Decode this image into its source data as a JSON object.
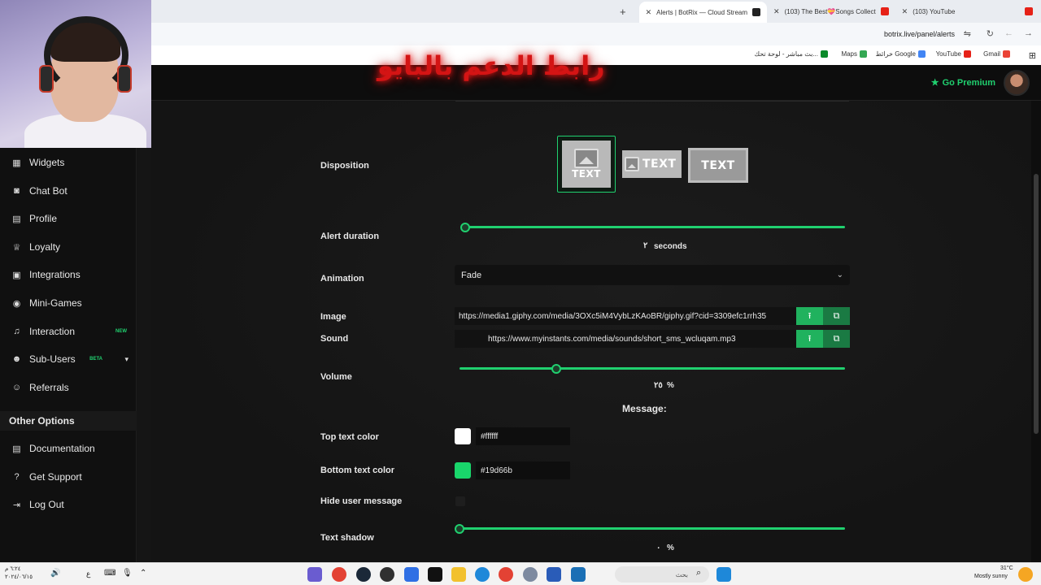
{
  "browser": {
    "tabs": [
      {
        "label": "Alerts | BotRix — Cloud Stream",
        "active": true
      },
      {
        "label": "(103) The Best💝Songs Collect",
        "active": false
      },
      {
        "label": "(103) YouTube",
        "active": false
      }
    ],
    "url": "botrix.live/panel/alerts",
    "bookmarks": [
      "بث مباشر - لوحة تحك...",
      "Maps",
      "خرائط Google",
      "YouTube",
      "Gmail"
    ]
  },
  "overlay_caption": "رابط الدعم بالبايو",
  "header": {
    "premium_label": "Go Premium"
  },
  "sidebar": {
    "items": [
      {
        "label": "Widgets",
        "icon": "widgets-icon"
      },
      {
        "label": "Chat Bot",
        "icon": "robot-icon"
      },
      {
        "label": "Profile",
        "icon": "profile-icon"
      },
      {
        "label": "Loyalty",
        "icon": "trophy-icon"
      },
      {
        "label": "Integrations",
        "icon": "integrations-icon"
      },
      {
        "label": "Mini-Games",
        "icon": "gamepad-icon"
      },
      {
        "label": "Interaction",
        "icon": "music-icon",
        "badge": "NEW"
      },
      {
        "label": "Sub-Users",
        "icon": "users-icon",
        "badge": "BETA"
      },
      {
        "label": "Referrals",
        "icon": "referrals-icon"
      }
    ],
    "other_header": "Other Options",
    "other_items": [
      {
        "label": "Documentation",
        "icon": "docs-icon"
      },
      {
        "label": "Get Support",
        "icon": "help-icon"
      },
      {
        "label": "Log Out",
        "icon": "logout-icon"
      }
    ]
  },
  "form": {
    "disposition_label": "Disposition",
    "disposition_text": "TEXT",
    "alert_duration_label": "Alert duration",
    "alert_duration_value": "٢",
    "alert_duration_unit": "seconds",
    "alert_duration_fraction": 0.0,
    "animation_label": "Animation",
    "animation_value": "Fade",
    "image_label": "Image",
    "image_url": "https://media1.giphy.com/media/3OXc5iM4VybLzKAoBR/giphy.gif?cid=3309efc1rrh35",
    "sound_label": "Sound",
    "sound_url": "https://www.myinstants.com/media/sounds/short_sms_wcluqam.mp3",
    "volume_label": "Volume",
    "volume_value": "٢٥",
    "volume_unit": "%",
    "volume_fraction": 0.25,
    "message_title": "Message:",
    "top_text_color_label": "Top text color",
    "top_text_color": "#ffffff",
    "bottom_text_color_label": "Bottom text color",
    "bottom_text_color": "#19d66b",
    "hide_user_message_label": "Hide user message",
    "text_shadow_label": "Text shadow",
    "text_shadow_value": "٠",
    "text_shadow_unit": "%",
    "text_shadow_fraction": 0.0
  },
  "taskbar": {
    "time": "٦:٢٤ م",
    "date": "٢٠٢٤/٠٦/١٥",
    "search_placeholder": "بحث",
    "weather_temp": "31°C",
    "weather_desc": "Mostly sunny",
    "lang": "ع"
  },
  "colors": {
    "accent": "#20d06f",
    "background": "#151515"
  }
}
